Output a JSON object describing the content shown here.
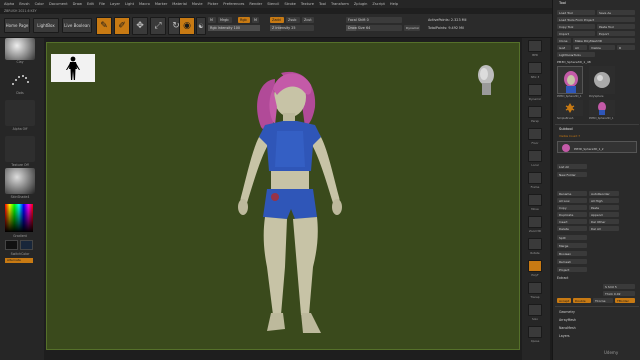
{
  "menubar": {
    "items": [
      "Alpha",
      "Brush",
      "Color",
      "Document",
      "Draw",
      "Edit",
      "File",
      "Layer",
      "Light",
      "Macro",
      "Marker",
      "Material",
      "Movie",
      "Picker",
      "Preferences",
      "Render",
      "Stencil",
      "Stroke",
      "Texture",
      "Tool",
      "Transform",
      "Zplugin",
      "Zscript",
      "Help"
    ],
    "right_items": [
      "Menus",
      "DefaultZScript"
    ]
  },
  "subbar": {
    "text": "ZBRUSH 2021.6 KEY"
  },
  "toolbar": {
    "home_page": "Home Page",
    "lightbox": "LightBox",
    "live_boolean": "Live Boolean",
    "edit_label": "Edit",
    "draw_label": "Draw",
    "move_label": "Move",
    "scale_label": "Scale",
    "rotate_label": "Rotate",
    "mrgb": "Mrgb",
    "rgb": "Rgb",
    "m": "M",
    "zadd": "Zadd",
    "zsub": "Zsub",
    "zcut": "Zcut",
    "z_intensity_label": "Z Intensity 25",
    "z_intensity_value": 0.25,
    "rgb_intensity_label": "Rgb Intensity 100",
    "rgb_intensity_value": 1.0,
    "focal_shift_label": "Focal Shift 0",
    "draw_size_label": "Draw Size 64",
    "dynamic_label": "Dynamic",
    "active_points": "ActivePoints: 2.323 Mil",
    "total_points": "TotalPoints: 9.492 Mil"
  },
  "leftshelf": {
    "items": [
      {
        "label": "Clay"
      },
      {
        "label": "Dots"
      },
      {
        "label": "Alpha Off"
      },
      {
        "label": "Texture Off"
      },
      {
        "label": "SkinShade4"
      }
    ],
    "gradient_label": "Gradient",
    "switch_color": "SwitchColor",
    "alternate": "Alternate"
  },
  "colors": {
    "canvas_bg": "#3a4a1c",
    "accent_orange": "#c87a13",
    "hair": "#c45aa8",
    "outfit": "#2f56b8",
    "skin": "#c7c3a6"
  },
  "rightcol": {
    "labels": [
      "BPR",
      "SPix 3",
      "Dynamic",
      "Persp",
      "Floor",
      "Local",
      "Frame",
      "Move",
      "Zoom3D",
      "Rotate",
      "PolyF",
      "Transp",
      "Solo",
      "Xpose"
    ]
  },
  "toolpanel": {
    "title": "Tool",
    "load_tool": "Load Tool",
    "save_as": "Save As",
    "load_tools_from_project": "Load Tools From Project",
    "copy_tool": "Copy Tool",
    "paste_tool": "Paste Tool",
    "import": "Import",
    "export": "Export",
    "clone": "Clone",
    "make_polymesh": "Make PolyMesh3D",
    "goz": "GoZ",
    "all": "All",
    "visible": "Visible",
    "r": "R",
    "lightbox_tools": "Lightbox▸Tools",
    "current_tool": "PM3D_Sphere3D_1_48",
    "thumbs": [
      {
        "label": "PM3D_Sphere3D_1"
      },
      {
        "label": "PolySphere"
      },
      {
        "label": "SimpleBrush"
      },
      {
        "label": "PM3D_Sphere3D_1"
      }
    ],
    "subtool_head": "Subtool",
    "visible_count": "Visible Count 7",
    "subtool_item": "PM3D_Sphere3D_1_2",
    "list_all": "List All",
    "new_folder": "New Folder",
    "rename": "Rename",
    "auto_reorder": "AutoReorder",
    "all_low": "All Low",
    "all_high": "All High",
    "copy": "Copy",
    "paste": "Paste",
    "duplicate": "Duplicate",
    "append": "Append",
    "insert": "Insert",
    "del_other": "Del Other",
    "delete": "Delete",
    "del_all": "Del All",
    "split": "Split",
    "merge": "Merge",
    "boolean": "Boolean",
    "remesh": "Remesh",
    "project": "Project",
    "extract": "Extract",
    "smt": "S Smt 5",
    "thick": "Thick 0.02",
    "accept": "Accept",
    "double": "Double",
    "tcorne": "TCorne",
    "tborder": "TBorder",
    "geometry": "Geometry",
    "arraymesh": "ArrayMesh",
    "nanomesh": "NanoMesh",
    "layers": "Layers"
  },
  "watermark": "Udemy"
}
